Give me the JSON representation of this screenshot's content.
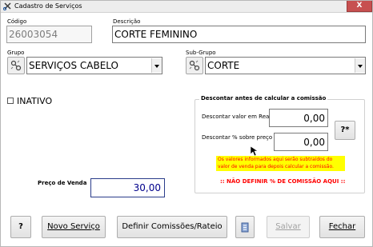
{
  "window": {
    "title": "Cadastro de Serviços",
    "close_label": "X"
  },
  "codigo": {
    "label": "Código",
    "value": "26003054"
  },
  "descricao": {
    "label": "Descrição",
    "value": "CORTE FEMININO"
  },
  "grupo": {
    "label": "Grupo",
    "value": "SERVIÇOS CABELO"
  },
  "subgrupo": {
    "label": "Sub-Grupo",
    "value": "CORTE"
  },
  "inativo": {
    "label": "INATIVO",
    "checked": false
  },
  "desconto": {
    "title": "Descontar antes de calcular a comissão",
    "reais_label": "Descontar valor em Reais",
    "reais_value": "0,00",
    "percent_label": "Descontar % sobre preço de venda",
    "percent_value": "0,00",
    "help_button": "?*",
    "note": "Os valores informados aqui serão subtraídos do valor de venda para depois calcular a comissão.",
    "warning": ":: NÃO DEFINIR % DE COMISSÃO AQUI ::"
  },
  "preco": {
    "label": "Preço de Venda",
    "value": "30,00"
  },
  "buttons": {
    "help": "?",
    "novo": "Novo Serviço",
    "definir": "Definir Comissões/Rateio",
    "salvar": "Salvar",
    "fechar": "Fechar"
  },
  "colors": {
    "warning_text": "#ff0000",
    "note_bg": "#ffff00",
    "preco_value": "#00008b",
    "close_bg": "#c75050"
  }
}
